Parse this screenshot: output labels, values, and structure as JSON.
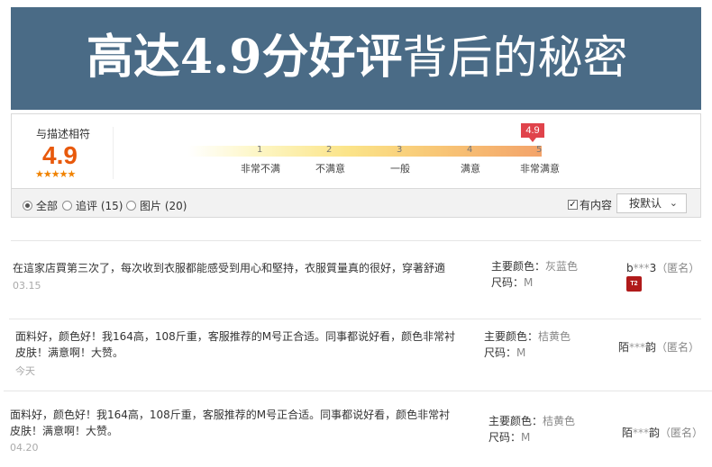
{
  "banner": {
    "title_bold": "高达4.9分好评",
    "title_light": "背后的秘密"
  },
  "rating": {
    "label": "与描述相符",
    "score": "4.9",
    "score_value": 4.9,
    "stars": "★★★★★",
    "marker": "4.9",
    "scale": [
      {
        "num": "1",
        "label": "非常不满"
      },
      {
        "num": "2",
        "label": "不满意"
      },
      {
        "num": "3",
        "label": "一般"
      },
      {
        "num": "4",
        "label": "满意"
      },
      {
        "num": "5",
        "label": "非常满意"
      }
    ]
  },
  "filters": {
    "options": [
      {
        "label": "全部",
        "selected": true
      },
      {
        "label": "追评 (15)",
        "selected": false
      },
      {
        "label": "图片 (20)",
        "selected": false
      }
    ],
    "has_content_label": "有内容",
    "has_content_checked": true,
    "check_mark": "✓",
    "sort_label": "按默认",
    "sort_chevron": "⌄"
  },
  "reviews": [
    {
      "text": "在這家店買第三次了，每次收到衣服都能感受到用心和堅持，衣服質量真的很好，穿著舒適",
      "date": "03.15",
      "color_label": "主要颜色：",
      "color_value": "灰蓝色",
      "size_label": "尺码：",
      "size_value": "M",
      "user_prefix": "b",
      "user_mask": "***",
      "user_suffix": "3",
      "anon": "（匿名）",
      "level_badge": "T2"
    },
    {
      "line1": "面料好，颜色好！我164高，108斤重，客服推荐的M号正合适。同事都说好看，颜色非常衬",
      "line2": "皮肤！满意啊！大赞。",
      "date": "今天",
      "color_label": "主要颜色：",
      "color_value": "桔黄色",
      "size_label": "尺码：",
      "size_value": "M",
      "user_prefix": "陌",
      "user_mask": "***",
      "user_suffix": "韵",
      "anon": "（匿名）"
    },
    {
      "line1": "面料好，颜色好！我164高，108斤重，客服推荐的M号正合适。同事都说好看，颜色非常衬",
      "line2": "皮肤！满意啊！大赞。",
      "date": "04.20",
      "color_label": "主要颜色：",
      "color_value": "桔黄色",
      "size_label": "尺码：",
      "size_value": "M",
      "user_prefix": "陌",
      "user_mask": "***",
      "user_suffix": "韵",
      "anon": "（匿名）"
    }
  ]
}
